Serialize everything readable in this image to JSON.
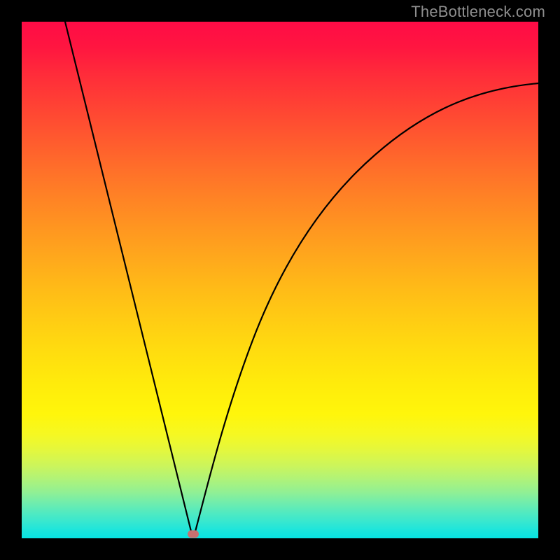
{
  "watermark": "TheBottleneck.com",
  "colors": {
    "frame": "#000000",
    "curve": "#000000",
    "marker": "#c97070",
    "gradient_top": "#ff0b46",
    "gradient_bottom": "#07e3e3",
    "watermark": "#8e8e8e"
  },
  "chart_data": {
    "type": "line",
    "title": "",
    "xlabel": "",
    "ylabel": "",
    "xlim": [
      0,
      100
    ],
    "ylim": [
      0,
      100
    ],
    "note": "Axes are unlabeled in the source image; x/y expressed as 0–100% of plot width/height. y increases upward (0 at bottom green band, 100 at top red band).",
    "series": [
      {
        "name": "left-branch",
        "x": [
          8.4,
          12,
          16,
          20,
          24,
          28,
          32,
          33.2
        ],
        "y": [
          100,
          85.4,
          69.2,
          53.0,
          36.8,
          20.6,
          4.5,
          0.8
        ]
      },
      {
        "name": "right-branch",
        "x": [
          33.5,
          36,
          40,
          44,
          48,
          52,
          56,
          60,
          66,
          72,
          80,
          90,
          100
        ],
        "y": [
          0.8,
          8,
          20,
          30,
          38.5,
          46,
          52.5,
          58,
          65,
          70.5,
          76,
          82,
          88.1
        ]
      }
    ],
    "annotations": [
      {
        "name": "minimum-marker",
        "shape": "rounded-pill",
        "x": 33.2,
        "y": 0.8,
        "color": "#c97070"
      }
    ],
    "background_gradient": {
      "direction": "vertical",
      "stops": [
        {
          "pos": 0.0,
          "color": "#ff0b46"
        },
        {
          "pos": 0.28,
          "color": "#ff6d2a"
        },
        {
          "pos": 0.52,
          "color": "#ffbc17"
        },
        {
          "pos": 0.76,
          "color": "#fff60b"
        },
        {
          "pos": 0.91,
          "color": "#92f093"
        },
        {
          "pos": 1.0,
          "color": "#07e3e3"
        }
      ]
    }
  }
}
